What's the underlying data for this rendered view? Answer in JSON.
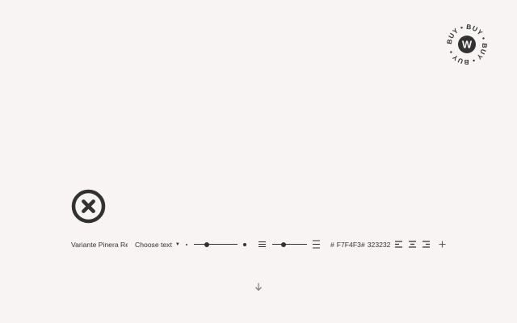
{
  "colors": {
    "background": "#F7F4F3",
    "foreground": "#323232"
  },
  "badge": {
    "ring_text": "BUY • BUY • BUY • BUY • ",
    "center_letter": "W"
  },
  "toolbar": {
    "font_name": "Variante Pinera Re...",
    "text_select": "Choose text",
    "size_slider_value": 0.3,
    "leading_slider_value": 0.33,
    "background_color": "F7F4F3",
    "foreground_color": "323232",
    "hash_symbol": "#"
  },
  "icons": {
    "close": "close-circle-icon",
    "caret": "caret-down-icon",
    "leading_tight": "line-spacing-tight-icon",
    "leading_loose": "line-spacing-loose-icon",
    "align_left": "align-left-icon",
    "align_center": "align-center-icon",
    "align_right": "align-right-icon",
    "add": "plus-icon",
    "scroll": "arrow-down-icon"
  }
}
